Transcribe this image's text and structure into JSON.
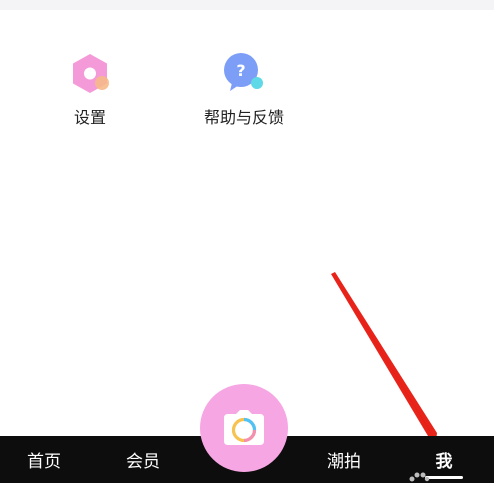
{
  "shortcuts": [
    {
      "label": "设置",
      "icon": "settings-hexagon-icon"
    },
    {
      "label": "帮助与反馈",
      "icon": "help-question-bubble-icon"
    }
  ],
  "tabbar": {
    "items": [
      {
        "label": "首页"
      },
      {
        "label": "会员"
      },
      {
        "label": "潮拍"
      },
      {
        "label": "我"
      }
    ],
    "active_index": 3,
    "camera_icon": "camera-icon"
  },
  "colors": {
    "tabbar_bg": "#0d0d0d",
    "camera_button": "#f6a6e3",
    "settings_icon": "#f59ad8",
    "help_icon": "#7d9ef7",
    "arrow": "#e8231a"
  }
}
